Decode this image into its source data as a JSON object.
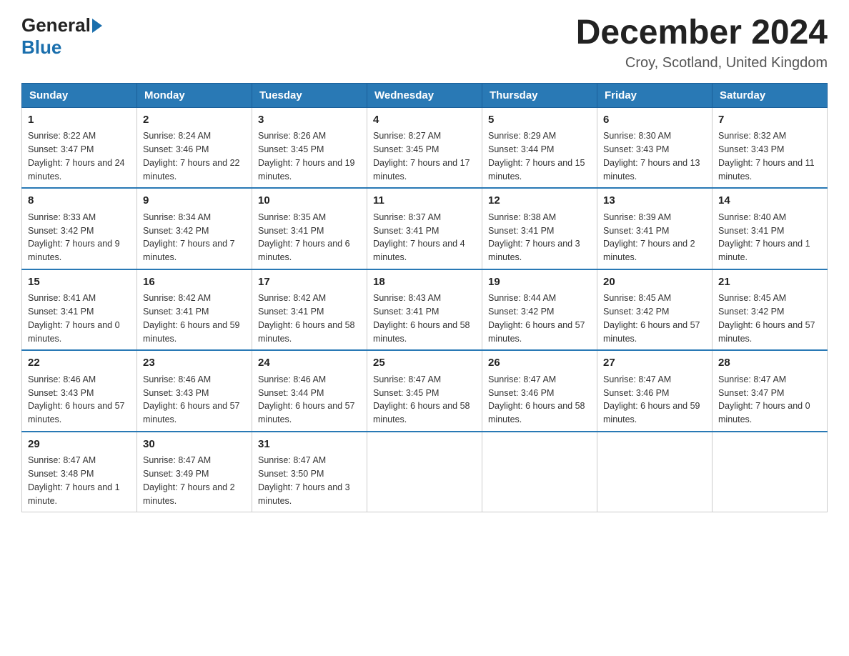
{
  "header": {
    "logo_general": "General",
    "logo_blue": "Blue",
    "month_title": "December 2024",
    "location": "Croy, Scotland, United Kingdom"
  },
  "days_of_week": [
    "Sunday",
    "Monday",
    "Tuesday",
    "Wednesday",
    "Thursday",
    "Friday",
    "Saturday"
  ],
  "weeks": [
    [
      {
        "day": "1",
        "sunrise": "8:22 AM",
        "sunset": "3:47 PM",
        "daylight": "7 hours and 24 minutes."
      },
      {
        "day": "2",
        "sunrise": "8:24 AM",
        "sunset": "3:46 PM",
        "daylight": "7 hours and 22 minutes."
      },
      {
        "day": "3",
        "sunrise": "8:26 AM",
        "sunset": "3:45 PM",
        "daylight": "7 hours and 19 minutes."
      },
      {
        "day": "4",
        "sunrise": "8:27 AM",
        "sunset": "3:45 PM",
        "daylight": "7 hours and 17 minutes."
      },
      {
        "day": "5",
        "sunrise": "8:29 AM",
        "sunset": "3:44 PM",
        "daylight": "7 hours and 15 minutes."
      },
      {
        "day": "6",
        "sunrise": "8:30 AM",
        "sunset": "3:43 PM",
        "daylight": "7 hours and 13 minutes."
      },
      {
        "day": "7",
        "sunrise": "8:32 AM",
        "sunset": "3:43 PM",
        "daylight": "7 hours and 11 minutes."
      }
    ],
    [
      {
        "day": "8",
        "sunrise": "8:33 AM",
        "sunset": "3:42 PM",
        "daylight": "7 hours and 9 minutes."
      },
      {
        "day": "9",
        "sunrise": "8:34 AM",
        "sunset": "3:42 PM",
        "daylight": "7 hours and 7 minutes."
      },
      {
        "day": "10",
        "sunrise": "8:35 AM",
        "sunset": "3:41 PM",
        "daylight": "7 hours and 6 minutes."
      },
      {
        "day": "11",
        "sunrise": "8:37 AM",
        "sunset": "3:41 PM",
        "daylight": "7 hours and 4 minutes."
      },
      {
        "day": "12",
        "sunrise": "8:38 AM",
        "sunset": "3:41 PM",
        "daylight": "7 hours and 3 minutes."
      },
      {
        "day": "13",
        "sunrise": "8:39 AM",
        "sunset": "3:41 PM",
        "daylight": "7 hours and 2 minutes."
      },
      {
        "day": "14",
        "sunrise": "8:40 AM",
        "sunset": "3:41 PM",
        "daylight": "7 hours and 1 minute."
      }
    ],
    [
      {
        "day": "15",
        "sunrise": "8:41 AM",
        "sunset": "3:41 PM",
        "daylight": "7 hours and 0 minutes."
      },
      {
        "day": "16",
        "sunrise": "8:42 AM",
        "sunset": "3:41 PM",
        "daylight": "6 hours and 59 minutes."
      },
      {
        "day": "17",
        "sunrise": "8:42 AM",
        "sunset": "3:41 PM",
        "daylight": "6 hours and 58 minutes."
      },
      {
        "day": "18",
        "sunrise": "8:43 AM",
        "sunset": "3:41 PM",
        "daylight": "6 hours and 58 minutes."
      },
      {
        "day": "19",
        "sunrise": "8:44 AM",
        "sunset": "3:42 PM",
        "daylight": "6 hours and 57 minutes."
      },
      {
        "day": "20",
        "sunrise": "8:45 AM",
        "sunset": "3:42 PM",
        "daylight": "6 hours and 57 minutes."
      },
      {
        "day": "21",
        "sunrise": "8:45 AM",
        "sunset": "3:42 PM",
        "daylight": "6 hours and 57 minutes."
      }
    ],
    [
      {
        "day": "22",
        "sunrise": "8:46 AM",
        "sunset": "3:43 PM",
        "daylight": "6 hours and 57 minutes."
      },
      {
        "day": "23",
        "sunrise": "8:46 AM",
        "sunset": "3:43 PM",
        "daylight": "6 hours and 57 minutes."
      },
      {
        "day": "24",
        "sunrise": "8:46 AM",
        "sunset": "3:44 PM",
        "daylight": "6 hours and 57 minutes."
      },
      {
        "day": "25",
        "sunrise": "8:47 AM",
        "sunset": "3:45 PM",
        "daylight": "6 hours and 58 minutes."
      },
      {
        "day": "26",
        "sunrise": "8:47 AM",
        "sunset": "3:46 PM",
        "daylight": "6 hours and 58 minutes."
      },
      {
        "day": "27",
        "sunrise": "8:47 AM",
        "sunset": "3:46 PM",
        "daylight": "6 hours and 59 minutes."
      },
      {
        "day": "28",
        "sunrise": "8:47 AM",
        "sunset": "3:47 PM",
        "daylight": "7 hours and 0 minutes."
      }
    ],
    [
      {
        "day": "29",
        "sunrise": "8:47 AM",
        "sunset": "3:48 PM",
        "daylight": "7 hours and 1 minute."
      },
      {
        "day": "30",
        "sunrise": "8:47 AM",
        "sunset": "3:49 PM",
        "daylight": "7 hours and 2 minutes."
      },
      {
        "day": "31",
        "sunrise": "8:47 AM",
        "sunset": "3:50 PM",
        "daylight": "7 hours and 3 minutes."
      },
      null,
      null,
      null,
      null
    ]
  ]
}
